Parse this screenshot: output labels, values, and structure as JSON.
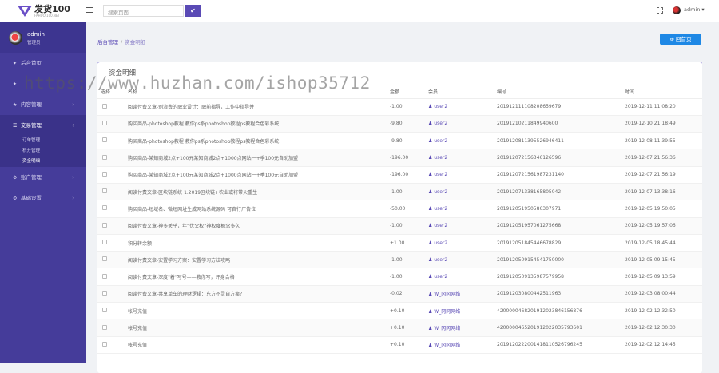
{
  "header": {
    "logo_text": "发货100",
    "logo_sub": "FAHUO 100.NET",
    "search_placeholder": "搜索页面",
    "search_btn": "✔",
    "user": "admin ▾"
  },
  "sidebar": {
    "profile_name": "admin",
    "profile_role": "管理员",
    "items": [
      {
        "icon": "✦",
        "label": "后台首页",
        "arrow": ""
      },
      {
        "icon": "✦",
        "label": "",
        "arrow": ""
      },
      {
        "icon": "★",
        "label": "内容管理",
        "arrow": "›"
      },
      {
        "icon": "☰",
        "label": "交易管理",
        "arrow": "‹"
      },
      {
        "icon": "⚙",
        "label": "账户管理",
        "arrow": "›"
      },
      {
        "icon": "⚙",
        "label": "基础设置",
        "arrow": "›"
      }
    ],
    "sub_items": [
      "订单管理",
      "积分管理",
      "资金明细"
    ]
  },
  "breadcrumb": {
    "root": "后台管理",
    "current": "资金明细"
  },
  "back_button": "⊕ 回首页",
  "panel_title": "资金明细",
  "table": {
    "headers": [
      "选择",
      "名称",
      "金额",
      "会员",
      "编号",
      "时间"
    ],
    "rows": [
      {
        "name": "阅读付费文章-别浪费的职业设计：职前指导，工作中指导并",
        "amount": "-1.00",
        "user": "user2",
        "no": "20191211110820865967​9",
        "time": "2019-12-11 11:08:20"
      },
      {
        "name": "购买商品-photoshop教程 教你ps系photoshop教程ps教程合色彩系统",
        "amount": "-9.80",
        "user": "user2",
        "no": "20191210211849940600",
        "time": "2019-12-10 21:18:49"
      },
      {
        "name": "购买商品-photoshop教程 教你ps系photoshop教程ps教程合色彩系统",
        "amount": "-9.80",
        "user": "user2",
        "no": "20191208113955269464​11",
        "time": "2019-12-08 11:39:55"
      },
      {
        "name": "购买商品-某知商城2点+100元某知商城2点+1000点网站一+季100元自助加盟",
        "amount": "-196.00",
        "user": "user2",
        "no": "20191207215634612659​6",
        "time": "2019-12-07 21:56:36"
      },
      {
        "name": "购买商品-某知商城2点+100元某知商城2点+1000点网站一+季100元自助加盟",
        "amount": "-196.00",
        "user": "user2",
        "no": "20191207215619872311​40",
        "time": "2019-12-07 21:56:19"
      },
      {
        "name": "阅读付费文章-区块链系统 1.2019区块链+农业或将带火重生",
        "amount": "-1.00",
        "user": "user2",
        "no": "20191207133816580504​2",
        "time": "2019-12-07 13:38:16"
      },
      {
        "name": "购买商品-短域名、微短网址生成网站系统源码 可自行广告位",
        "amount": "-50.00",
        "user": "user2",
        "no": "20191205195058630797​1",
        "time": "2019-12-05 19:50:05"
      },
      {
        "name": "阅读付费文章-神多关乎，年“优父权”神权度概念多久",
        "amount": "-1.00",
        "user": "user2",
        "no": "20191205195706127566​8",
        "time": "2019-12-05 19:57:06"
      },
      {
        "name": "积分转余额",
        "amount": "+1.00",
        "user": "user2",
        "no": "20191205184544667882​9",
        "time": "2019-12-05 18:45:44"
      },
      {
        "name": "阅读付费文章-安置学习方案：安置学习方法攻略",
        "amount": "-1.00",
        "user": "user2",
        "no": "20191205091545417500​00",
        "time": "2019-12-05 09:15:45"
      },
      {
        "name": "阅读付费文章-深度\"着\"写号——教你写，评身合格",
        "amount": "-1.00",
        "user": "user2",
        "no": "20191205091359875799​58",
        "time": "2019-12-05 09:13:59"
      },
      {
        "name": "阅读付费文章-共享单车的理财逻辑：东方不灵自方案？",
        "amount": "-0.02",
        "user": "W_冈冈网络",
        "no": "2019120308004425119​63",
        "time": "2019-12-03 08:00:44"
      },
      {
        "name": "帐号充值",
        "amount": "+0.10",
        "user": "W_冈冈网络",
        "no": "4200000468201912023​84615687​6",
        "time": "2019-12-02 12:32:50"
      },
      {
        "name": "帐号充值",
        "amount": "+0.10",
        "user": "W_冈冈网络",
        "no": "4200000465201912022​0357936​01",
        "time": "2019-12-02 12:30:30"
      },
      {
        "name": "帐号充值",
        "amount": "+0.10",
        "user": "W_冈冈网络",
        "no": "2019120222001418110​5267962​45",
        "time": "2019-12-02 12:14:45"
      }
    ]
  },
  "watermark": "https://www.huzhan.com/ishop35712"
}
